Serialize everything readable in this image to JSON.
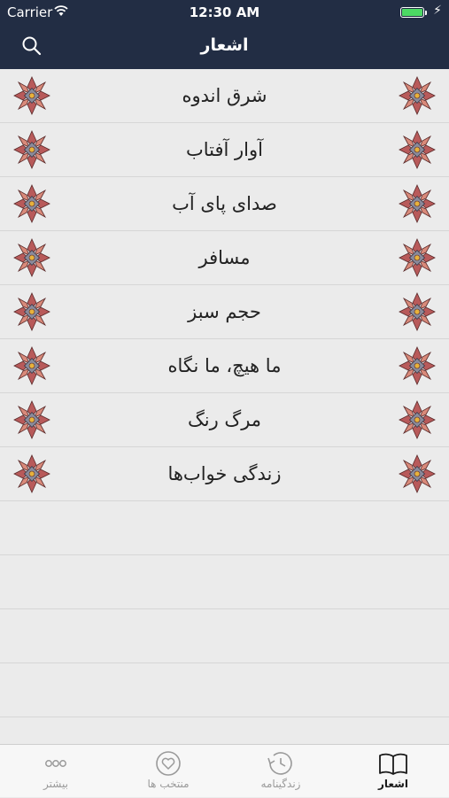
{
  "status_bar": {
    "carrier": "Carrier",
    "time": "12:30 AM"
  },
  "nav": {
    "title": "اشعار"
  },
  "poems": [
    "شرق اندوه",
    "آوار آفتاب",
    "صدای پای آب",
    "مسافر",
    "حجم سبز",
    "ما هیچ، ما نگاه",
    "مرگ رنگ",
    "زندگی خواب‌ها"
  ],
  "tabs": [
    {
      "label": "بیشتر",
      "icon": "more-dots-icon"
    },
    {
      "label": "منتخب ها",
      "icon": "heart-circle-icon"
    },
    {
      "label": "زندگینامه",
      "icon": "clock-history-icon"
    },
    {
      "label": "اشعار",
      "icon": "open-book-icon",
      "active": true
    }
  ],
  "colors": {
    "bar": "#222d44",
    "background": "#ebebeb",
    "battery": "#4cd964"
  }
}
